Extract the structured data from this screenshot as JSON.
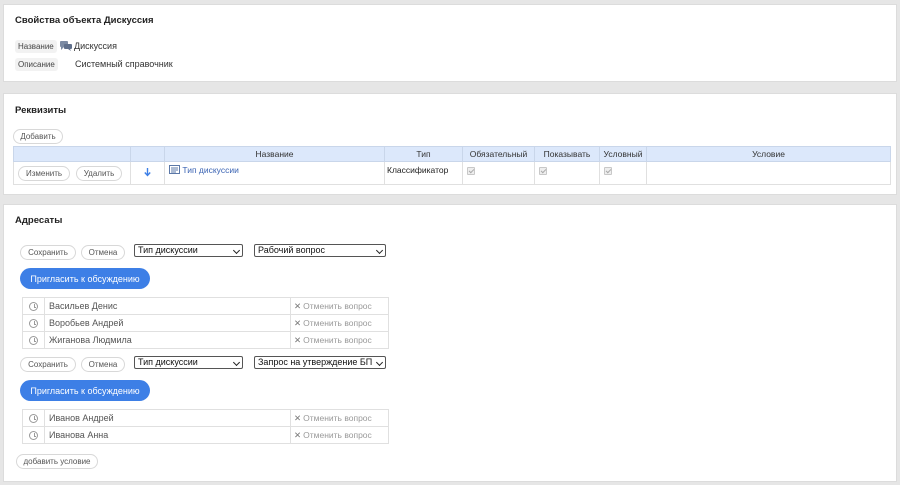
{
  "object_props": {
    "title": "Свойства объекта Дискуссия",
    "name_label": "Название",
    "name_value": "Дискуссия",
    "name_icon": "chat-bubbles-icon",
    "desc_label": "Описание",
    "desc_value": "Системный справочник"
  },
  "requisites": {
    "title": "Реквизиты",
    "add_label": "Добавить",
    "columns": [
      "",
      "",
      "Название",
      "Тип",
      "Обязательный",
      "Показывать",
      "Условный",
      "Условие"
    ],
    "rows": [
      {
        "edit_label": "Изменить",
        "delete_label": "Удалить",
        "name": "Тип дискуссии",
        "type": "Классификатор",
        "required": true,
        "show": true,
        "conditional": true,
        "condition": ""
      }
    ]
  },
  "recipients": {
    "title": "Адресаты",
    "groups": [
      {
        "save_label": "Сохранить",
        "cancel_label": "Отмена",
        "select1_value": "Тип дискуссии",
        "select2_value": "Рабочий вопрос",
        "invite_label": "Пригласить к обсуждению",
        "people": [
          {
            "name": "Васильев Денис",
            "action": "Отменить вопрос"
          },
          {
            "name": "Воробьев Андрей",
            "action": "Отменить вопрос"
          },
          {
            "name": "Жиганова Людмила",
            "action": "Отменить вопрос"
          }
        ]
      },
      {
        "save_label": "Сохранить",
        "cancel_label": "Отмена",
        "select1_value": "Тип дискуссии",
        "select2_value": "Запрос на утверждение БП",
        "invite_label": "Пригласить к обсуждению",
        "people": [
          {
            "name": "Иванов Андрей",
            "action": "Отменить вопрос"
          },
          {
            "name": "Иванова Анна",
            "action": "Отменить вопрос"
          }
        ]
      }
    ],
    "add_condition_label": "добавить условие"
  }
}
